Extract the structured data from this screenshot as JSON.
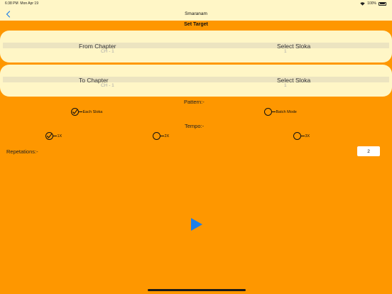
{
  "status_bar": {
    "time": "6:38 PM",
    "date": "Mon Apr 19",
    "battery": "100%"
  },
  "nav": {
    "title": "Smaranam",
    "back_icon": "chevron-left-icon"
  },
  "section_title": "Set Target",
  "from_picker": {
    "left_label": "From Chapter",
    "left_value": "CH - 1",
    "right_label": "Select Sloka",
    "right_value": "1"
  },
  "to_picker": {
    "left_label": "To Chapter",
    "left_value": "CH - 1",
    "right_label": "Select Sloka",
    "right_value": "1"
  },
  "pattern": {
    "label": "Pattern:-",
    "options": [
      {
        "label": "Each Sloka",
        "selected": true
      },
      {
        "label": "Batch Mode",
        "selected": false
      }
    ]
  },
  "tempo": {
    "label": "Tempo:-",
    "options": [
      {
        "label": "1X",
        "selected": true
      },
      {
        "label": "2X",
        "selected": false
      },
      {
        "label": "3X",
        "selected": false
      }
    ]
  },
  "repetitions": {
    "label": "Repetations:-",
    "value": "2"
  },
  "colors": {
    "background": "#fe9700",
    "panel": "#fff6c6",
    "play_accent": "#1e7fe8"
  }
}
